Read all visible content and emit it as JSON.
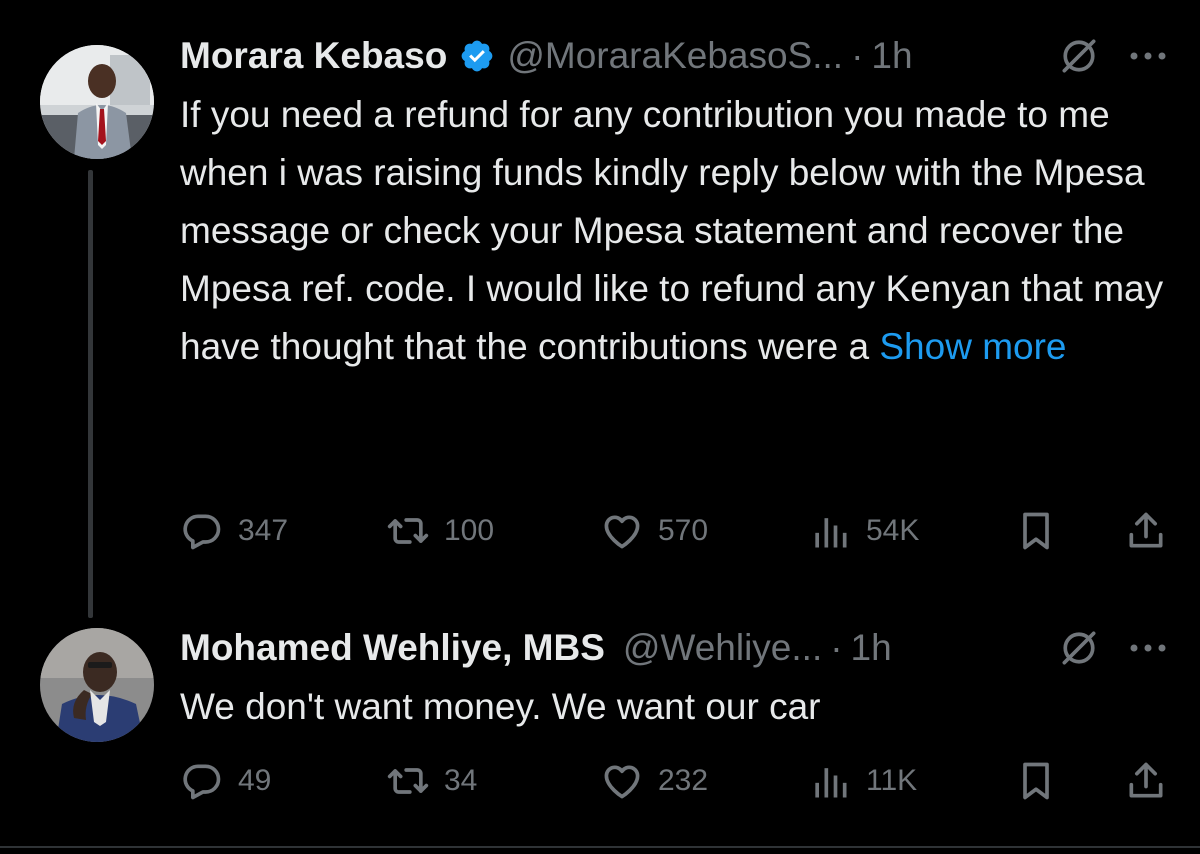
{
  "tweets": [
    {
      "author_name": "Morara Kebaso",
      "verified": true,
      "handle": "@MoraraKebasoS...",
      "dot": "·",
      "time": "1h",
      "text": "If you need a refund for any contribution you made to me when i was raising funds kindly reply below with the Mpesa message or check your Mpesa statement and recover the Mpesa ref. code. I would like to refund any Kenyan that may have thought that the contributions were a ",
      "show_more": "Show more",
      "replies": "347",
      "reposts": "100",
      "likes": "570",
      "views": "54K"
    },
    {
      "author_name": "Mohamed Wehliye, MBS",
      "verified": false,
      "handle": "@Wehliye...",
      "dot": "·",
      "time": "1h",
      "text": "We don't want money. We want our car",
      "replies": "49",
      "reposts": "34",
      "likes": "232",
      "views": "11K"
    }
  ],
  "icons": {
    "reply": "reply-icon",
    "repost": "repost-icon",
    "like": "heart-icon",
    "views": "views-icon",
    "bookmark": "bookmark-icon",
    "share": "share-icon",
    "grok": "grok-icon",
    "more": "more-icon",
    "verified": "verified-badge-icon"
  },
  "colors": {
    "background": "#000000",
    "text": "#e7e9ea",
    "muted": "#71767b",
    "link": "#1d9bf0",
    "thread_line": "#333639"
  }
}
